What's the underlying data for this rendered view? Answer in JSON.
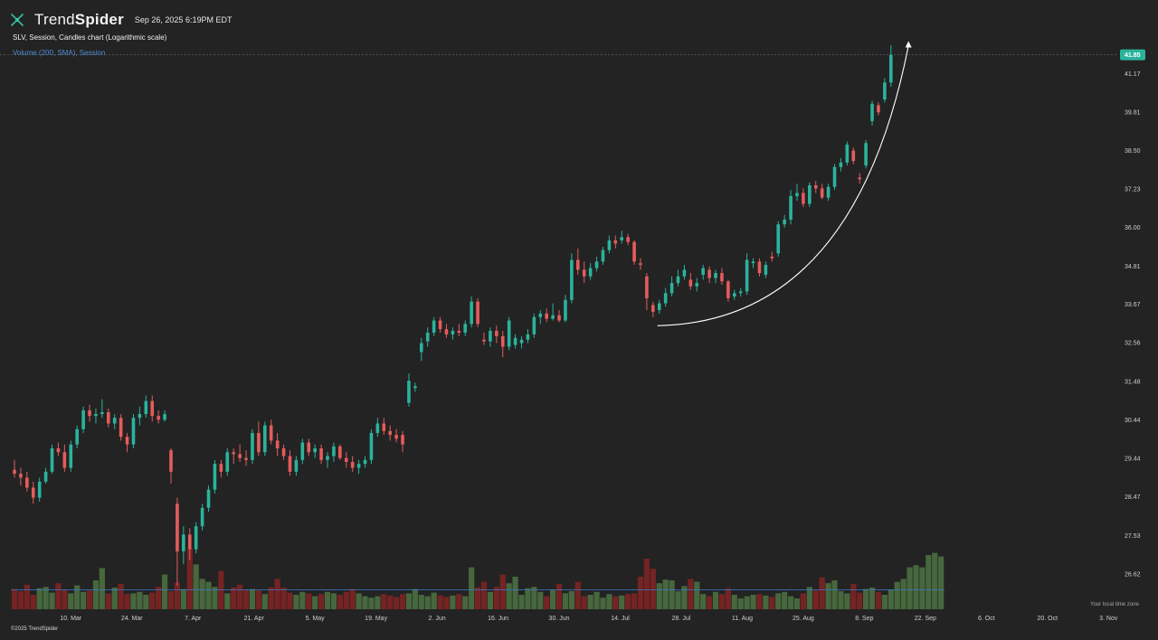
{
  "header": {
    "brand_regular": "Trend",
    "brand_bold": "Spider",
    "timestamp": "Sep 26, 2025 6:19PM EDT",
    "chart_title": "SLV, Session, Candles chart (Logarithmic scale)",
    "volume_label": "Volume (200, SMA), Session",
    "copyright": "©2025 TrendSpider",
    "timezone_note": "Your local time zone"
  },
  "colors": {
    "background": "#232323",
    "up": "#2bb39c",
    "down": "#e55c5c",
    "volume_up": "#4a6b3f",
    "volume_down": "#7a2424",
    "sma_line": "#3b7ad0",
    "price_label_bg": "#2bb39c"
  },
  "chart_data": {
    "type": "candlestick",
    "title": "SLV, Session, Candles chart (Logarithmic scale)",
    "y_scale": "log",
    "ylim": [
      26.1,
      42.4
    ],
    "y_ticks": [
      "41.17",
      "39.81",
      "38.50",
      "37.23",
      "36.00",
      "34.81",
      "33.67",
      "32.56",
      "31.48",
      "30.44",
      "29.44",
      "28.47",
      "27.53",
      "26.62"
    ],
    "last_price": "41.85",
    "x_ticks": [
      "10. Mar",
      "24. Mar",
      "7. Apr",
      "21. Apr",
      "5. May",
      "19. May",
      "2. Jun",
      "16. Jun",
      "30. Jun",
      "14. Jul",
      "28. Jul",
      "11. Aug",
      "25. Aug",
      "8. Sep",
      "22. Sep",
      "6. Oct",
      "20. Oct",
      "3. Nov"
    ],
    "candles": [
      {
        "o": 29.15,
        "h": 29.4,
        "l": 28.95,
        "c": 29.05
      },
      {
        "o": 29.05,
        "h": 29.2,
        "l": 28.75,
        "c": 28.95
      },
      {
        "o": 28.95,
        "h": 29.1,
        "l": 28.6,
        "c": 28.7
      },
      {
        "o": 28.7,
        "h": 28.85,
        "l": 28.3,
        "c": 28.45
      },
      {
        "o": 28.45,
        "h": 28.95,
        "l": 28.35,
        "c": 28.85
      },
      {
        "o": 28.85,
        "h": 29.2,
        "l": 28.8,
        "c": 29.1
      },
      {
        "o": 29.1,
        "h": 29.8,
        "l": 29.05,
        "c": 29.7
      },
      {
        "o": 29.7,
        "h": 29.85,
        "l": 29.5,
        "c": 29.6
      },
      {
        "o": 29.6,
        "h": 29.8,
        "l": 29.1,
        "c": 29.2
      },
      {
        "o": 29.2,
        "h": 29.9,
        "l": 29.1,
        "c": 29.8
      },
      {
        "o": 29.8,
        "h": 30.3,
        "l": 29.7,
        "c": 30.2
      },
      {
        "o": 30.2,
        "h": 30.8,
        "l": 30.1,
        "c": 30.7
      },
      {
        "o": 30.7,
        "h": 30.85,
        "l": 30.4,
        "c": 30.55
      },
      {
        "o": 30.55,
        "h": 30.75,
        "l": 30.35,
        "c": 30.6
      },
      {
        "o": 30.6,
        "h": 31.0,
        "l": 30.5,
        "c": 30.65
      },
      {
        "o": 30.65,
        "h": 30.75,
        "l": 30.25,
        "c": 30.35
      },
      {
        "o": 30.35,
        "h": 30.6,
        "l": 30.2,
        "c": 30.5
      },
      {
        "o": 30.5,
        "h": 30.6,
        "l": 29.9,
        "c": 30.0
      },
      {
        "o": 30.0,
        "h": 30.1,
        "l": 29.6,
        "c": 29.8
      },
      {
        "o": 29.8,
        "h": 30.6,
        "l": 29.7,
        "c": 30.5
      },
      {
        "o": 30.5,
        "h": 30.8,
        "l": 30.3,
        "c": 30.6
      },
      {
        "o": 30.6,
        "h": 31.1,
        "l": 30.5,
        "c": 30.95
      },
      {
        "o": 30.95,
        "h": 31.1,
        "l": 30.4,
        "c": 30.55
      },
      {
        "o": 30.55,
        "h": 30.7,
        "l": 30.35,
        "c": 30.45
      },
      {
        "o": 30.45,
        "h": 30.7,
        "l": 30.4,
        "c": 30.6
      },
      {
        "o": 29.65,
        "h": 29.7,
        "l": 28.8,
        "c": 29.1
      },
      {
        "o": 28.3,
        "h": 28.45,
        "l": 26.35,
        "c": 27.15
      },
      {
        "o": 27.15,
        "h": 27.75,
        "l": 26.85,
        "c": 27.55
      },
      {
        "o": 27.55,
        "h": 27.7,
        "l": 26.95,
        "c": 27.2
      },
      {
        "o": 27.2,
        "h": 27.85,
        "l": 27.1,
        "c": 27.75
      },
      {
        "o": 27.75,
        "h": 28.3,
        "l": 27.65,
        "c": 28.2
      },
      {
        "o": 28.2,
        "h": 28.75,
        "l": 28.1,
        "c": 28.65
      },
      {
        "o": 28.65,
        "h": 29.4,
        "l": 28.55,
        "c": 29.3
      },
      {
        "o": 29.3,
        "h": 29.4,
        "l": 28.95,
        "c": 29.1
      },
      {
        "o": 29.1,
        "h": 29.7,
        "l": 29.0,
        "c": 29.6
      },
      {
        "o": 29.6,
        "h": 29.7,
        "l": 29.3,
        "c": 29.55
      },
      {
        "o": 29.55,
        "h": 29.8,
        "l": 29.35,
        "c": 29.45
      },
      {
        "o": 29.45,
        "h": 29.65,
        "l": 29.25,
        "c": 29.4
      },
      {
        "o": 29.4,
        "h": 30.2,
        "l": 29.3,
        "c": 30.1
      },
      {
        "o": 30.1,
        "h": 30.4,
        "l": 29.5,
        "c": 29.6
      },
      {
        "o": 29.6,
        "h": 30.4,
        "l": 29.5,
        "c": 30.3
      },
      {
        "o": 30.3,
        "h": 30.45,
        "l": 29.8,
        "c": 29.9
      },
      {
        "o": 29.9,
        "h": 30.1,
        "l": 29.5,
        "c": 29.7
      },
      {
        "o": 29.7,
        "h": 29.8,
        "l": 29.4,
        "c": 29.5
      },
      {
        "o": 29.5,
        "h": 29.65,
        "l": 29.0,
        "c": 29.1
      },
      {
        "o": 29.1,
        "h": 29.5,
        "l": 29.0,
        "c": 29.4
      },
      {
        "o": 29.4,
        "h": 29.95,
        "l": 29.3,
        "c": 29.85
      },
      {
        "o": 29.85,
        "h": 29.95,
        "l": 29.5,
        "c": 29.6
      },
      {
        "o": 29.6,
        "h": 29.8,
        "l": 29.45,
        "c": 29.7
      },
      {
        "o": 29.7,
        "h": 29.8,
        "l": 29.3,
        "c": 29.4
      },
      {
        "o": 29.4,
        "h": 29.6,
        "l": 29.2,
        "c": 29.5
      },
      {
        "o": 29.5,
        "h": 29.85,
        "l": 29.35,
        "c": 29.75
      },
      {
        "o": 29.75,
        "h": 29.8,
        "l": 29.4,
        "c": 29.45
      },
      {
        "o": 29.45,
        "h": 29.6,
        "l": 29.2,
        "c": 29.35
      },
      {
        "o": 29.35,
        "h": 29.5,
        "l": 29.1,
        "c": 29.2
      },
      {
        "o": 29.2,
        "h": 29.4,
        "l": 29.05,
        "c": 29.3
      },
      {
        "o": 29.3,
        "h": 29.5,
        "l": 29.2,
        "c": 29.4
      },
      {
        "o": 29.4,
        "h": 30.2,
        "l": 29.3,
        "c": 30.1
      },
      {
        "o": 30.1,
        "h": 30.5,
        "l": 30.0,
        "c": 30.35
      },
      {
        "o": 30.35,
        "h": 30.5,
        "l": 30.05,
        "c": 30.15
      },
      {
        "o": 30.15,
        "h": 30.3,
        "l": 29.9,
        "c": 30.05
      },
      {
        "o": 30.05,
        "h": 30.2,
        "l": 29.85,
        "c": 29.95
      },
      {
        "o": 30.05,
        "h": 30.15,
        "l": 29.6,
        "c": 29.8
      },
      {
        "o": 30.9,
        "h": 31.7,
        "l": 30.8,
        "c": 31.5
      },
      {
        "o": 31.3,
        "h": 31.45,
        "l": 31.2,
        "c": 31.35
      },
      {
        "o": 32.3,
        "h": 32.7,
        "l": 32.05,
        "c": 32.55
      },
      {
        "o": 32.6,
        "h": 33.0,
        "l": 32.45,
        "c": 32.85
      },
      {
        "o": 32.85,
        "h": 33.3,
        "l": 32.75,
        "c": 33.2
      },
      {
        "o": 33.2,
        "h": 33.3,
        "l": 32.85,
        "c": 32.95
      },
      {
        "o": 32.95,
        "h": 33.1,
        "l": 32.7,
        "c": 32.8
      },
      {
        "o": 32.8,
        "h": 33.0,
        "l": 32.65,
        "c": 32.9
      },
      {
        "o": 32.9,
        "h": 33.1,
        "l": 32.75,
        "c": 32.85
      },
      {
        "o": 32.85,
        "h": 33.2,
        "l": 32.75,
        "c": 33.1
      },
      {
        "o": 33.1,
        "h": 33.9,
        "l": 33.0,
        "c": 33.75
      },
      {
        "o": 33.75,
        "h": 33.85,
        "l": 33.0,
        "c": 33.1
      },
      {
        "o": 32.65,
        "h": 32.85,
        "l": 32.5,
        "c": 32.6
      },
      {
        "o": 32.6,
        "h": 33.0,
        "l": 32.45,
        "c": 32.9
      },
      {
        "o": 32.9,
        "h": 33.05,
        "l": 32.55,
        "c": 32.75
      },
      {
        "o": 32.75,
        "h": 32.9,
        "l": 32.15,
        "c": 32.45
      },
      {
        "o": 32.45,
        "h": 33.3,
        "l": 32.35,
        "c": 33.2
      },
      {
        "o": 32.5,
        "h": 32.8,
        "l": 32.4,
        "c": 32.7
      },
      {
        "o": 32.55,
        "h": 32.75,
        "l": 32.4,
        "c": 32.65
      },
      {
        "o": 32.65,
        "h": 32.95,
        "l": 32.55,
        "c": 32.8
      },
      {
        "o": 32.8,
        "h": 33.4,
        "l": 32.7,
        "c": 33.3
      },
      {
        "o": 33.3,
        "h": 33.5,
        "l": 33.1,
        "c": 33.4
      },
      {
        "o": 33.4,
        "h": 33.55,
        "l": 33.15,
        "c": 33.25
      },
      {
        "o": 33.25,
        "h": 33.7,
        "l": 33.2,
        "c": 33.35
      },
      {
        "o": 33.35,
        "h": 33.5,
        "l": 33.15,
        "c": 33.2
      },
      {
        "o": 33.2,
        "h": 33.95,
        "l": 33.15,
        "c": 33.8
      },
      {
        "o": 33.8,
        "h": 35.2,
        "l": 33.7,
        "c": 35.0
      },
      {
        "o": 35.0,
        "h": 35.35,
        "l": 34.55,
        "c": 34.7
      },
      {
        "o": 34.7,
        "h": 34.95,
        "l": 34.3,
        "c": 34.5
      },
      {
        "o": 34.5,
        "h": 34.9,
        "l": 34.4,
        "c": 34.75
      },
      {
        "o": 34.75,
        "h": 35.1,
        "l": 34.65,
        "c": 34.95
      },
      {
        "o": 34.95,
        "h": 35.4,
        "l": 34.85,
        "c": 35.3
      },
      {
        "o": 35.3,
        "h": 35.75,
        "l": 35.2,
        "c": 35.6
      },
      {
        "o": 35.6,
        "h": 35.75,
        "l": 35.35,
        "c": 35.5
      },
      {
        "o": 35.6,
        "h": 35.9,
        "l": 35.5,
        "c": 35.7
      },
      {
        "o": 35.7,
        "h": 35.8,
        "l": 35.45,
        "c": 35.55
      },
      {
        "o": 35.55,
        "h": 35.6,
        "l": 34.85,
        "c": 34.95
      },
      {
        "o": 34.9,
        "h": 35.05,
        "l": 34.7,
        "c": 34.85
      },
      {
        "o": 34.5,
        "h": 34.6,
        "l": 33.5,
        "c": 33.85
      },
      {
        "o": 33.65,
        "h": 33.75,
        "l": 33.3,
        "c": 33.45
      },
      {
        "o": 33.5,
        "h": 33.8,
        "l": 33.4,
        "c": 33.7
      },
      {
        "o": 33.7,
        "h": 34.15,
        "l": 33.6,
        "c": 34.0
      },
      {
        "o": 34.0,
        "h": 34.5,
        "l": 33.9,
        "c": 34.3
      },
      {
        "o": 34.3,
        "h": 34.7,
        "l": 34.2,
        "c": 34.5
      },
      {
        "o": 34.5,
        "h": 34.85,
        "l": 34.4,
        "c": 34.7
      },
      {
        "o": 34.4,
        "h": 34.6,
        "l": 34.1,
        "c": 34.2
      },
      {
        "o": 34.2,
        "h": 34.45,
        "l": 34.05,
        "c": 34.3
      },
      {
        "o": 34.55,
        "h": 34.85,
        "l": 34.4,
        "c": 34.75
      },
      {
        "o": 34.7,
        "h": 34.8,
        "l": 34.3,
        "c": 34.45
      },
      {
        "o": 34.45,
        "h": 34.7,
        "l": 34.3,
        "c": 34.6
      },
      {
        "o": 34.6,
        "h": 34.75,
        "l": 34.25,
        "c": 34.35
      },
      {
        "o": 34.35,
        "h": 34.4,
        "l": 33.75,
        "c": 33.85
      },
      {
        "o": 33.9,
        "h": 34.1,
        "l": 33.8,
        "c": 34.0
      },
      {
        "o": 34.0,
        "h": 34.15,
        "l": 33.9,
        "c": 34.05
      },
      {
        "o": 34.05,
        "h": 35.2,
        "l": 33.95,
        "c": 35.0
      },
      {
        "o": 34.9,
        "h": 35.05,
        "l": 34.75,
        "c": 34.95
      },
      {
        "o": 34.95,
        "h": 35.05,
        "l": 34.5,
        "c": 34.6
      },
      {
        "o": 34.55,
        "h": 34.95,
        "l": 34.45,
        "c": 34.85
      },
      {
        "o": 35.1,
        "h": 35.25,
        "l": 34.95,
        "c": 35.05
      },
      {
        "o": 35.2,
        "h": 36.2,
        "l": 35.1,
        "c": 36.1
      },
      {
        "o": 36.1,
        "h": 36.4,
        "l": 36.0,
        "c": 36.25
      },
      {
        "o": 36.25,
        "h": 37.2,
        "l": 36.1,
        "c": 37.0
      },
      {
        "o": 37.0,
        "h": 37.4,
        "l": 36.85,
        "c": 37.1
      },
      {
        "o": 37.1,
        "h": 37.25,
        "l": 36.65,
        "c": 36.75
      },
      {
        "o": 36.75,
        "h": 37.45,
        "l": 36.65,
        "c": 37.35
      },
      {
        "o": 37.35,
        "h": 37.5,
        "l": 37.1,
        "c": 37.25
      },
      {
        "o": 37.25,
        "h": 37.4,
        "l": 36.9,
        "c": 36.95
      },
      {
        "o": 36.95,
        "h": 37.4,
        "l": 36.85,
        "c": 37.3
      },
      {
        "o": 37.3,
        "h": 38.05,
        "l": 37.2,
        "c": 37.95
      },
      {
        "o": 37.95,
        "h": 38.25,
        "l": 37.8,
        "c": 38.1
      },
      {
        "o": 38.1,
        "h": 38.8,
        "l": 38.0,
        "c": 38.7
      },
      {
        "o": 38.5,
        "h": 38.6,
        "l": 38.05,
        "c": 38.15
      },
      {
        "o": 37.6,
        "h": 37.75,
        "l": 37.4,
        "c": 37.55
      },
      {
        "o": 38.0,
        "h": 38.85,
        "l": 37.9,
        "c": 38.75
      },
      {
        "o": 39.5,
        "h": 40.2,
        "l": 39.35,
        "c": 40.1
      },
      {
        "o": 40.05,
        "h": 40.15,
        "l": 39.7,
        "c": 39.8
      },
      {
        "o": 40.25,
        "h": 41.0,
        "l": 40.15,
        "c": 40.85
      },
      {
        "o": 40.85,
        "h": 42.2,
        "l": 40.7,
        "c": 41.85
      }
    ],
    "volume": {
      "label": "Volume (200, SMA), Session",
      "sma_level": 0.27,
      "bars": [
        0.28,
        0.25,
        0.34,
        0.2,
        0.29,
        0.31,
        0.23,
        0.36,
        0.27,
        0.22,
        0.33,
        0.24,
        0.26,
        0.4,
        0.57,
        0.22,
        0.3,
        0.35,
        0.21,
        0.22,
        0.24,
        0.2,
        0.23,
        0.31,
        0.48,
        0.25,
        0.37,
        0.28,
        0.85,
        0.62,
        0.42,
        0.38,
        0.31,
        0.53,
        0.22,
        0.3,
        0.34,
        0.27,
        0.28,
        0.26,
        0.21,
        0.3,
        0.42,
        0.3,
        0.23,
        0.2,
        0.24,
        0.22,
        0.18,
        0.21,
        0.24,
        0.22,
        0.2,
        0.24,
        0.28,
        0.22,
        0.18,
        0.16,
        0.18,
        0.21,
        0.19,
        0.17,
        0.21,
        0.22,
        0.28,
        0.2,
        0.18,
        0.23,
        0.19,
        0.17,
        0.19,
        0.21,
        0.18,
        0.58,
        0.3,
        0.38,
        0.24,
        0.31,
        0.48,
        0.36,
        0.45,
        0.2,
        0.29,
        0.31,
        0.24,
        0.18,
        0.27,
        0.35,
        0.22,
        0.25,
        0.38,
        0.18,
        0.2,
        0.24,
        0.16,
        0.21,
        0.18,
        0.19,
        0.21,
        0.22,
        0.45,
        0.7,
        0.56,
        0.36,
        0.41,
        0.4,
        0.25,
        0.32,
        0.42,
        0.38,
        0.21,
        0.18,
        0.24,
        0.21,
        0.29,
        0.2,
        0.15,
        0.18,
        0.2,
        0.21,
        0.19,
        0.17,
        0.22,
        0.24,
        0.18,
        0.15,
        0.22,
        0.31,
        0.26,
        0.44,
        0.36,
        0.4,
        0.25,
        0.22,
        0.35,
        0.23,
        0.28,
        0.3,
        0.24,
        0.2,
        0.27,
        0.38,
        0.42,
        0.58,
        0.61,
        0.58,
        0.75,
        0.78,
        0.73
      ]
    }
  }
}
